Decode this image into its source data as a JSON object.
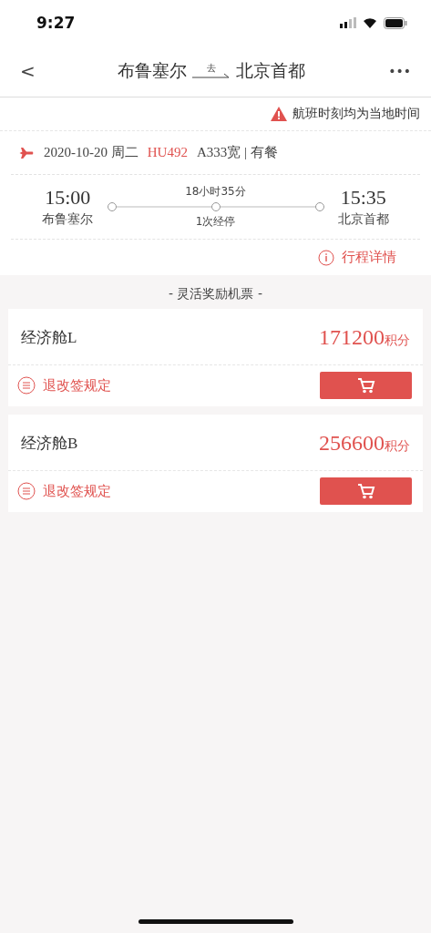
{
  "status_bar": {
    "time": "9:27"
  },
  "nav": {
    "back": "<",
    "origin": "布鲁塞尔",
    "direction": "去",
    "destination": "北京首都",
    "more": "•••"
  },
  "notice": "航班时刻均为当地时间",
  "flight": {
    "date": "2020-10-20 周二",
    "flight_no": "HU492",
    "aircraft": "A333宽 | 有餐",
    "depart_time": "15:00",
    "depart_city": "布鲁塞尔",
    "duration": "18小时35分",
    "stops": "1次经停",
    "arrive_time": "15:35",
    "arrive_city": "北京首都",
    "details_link": "行程详情"
  },
  "section_title": "- 灵活奖励机票 -",
  "fares": [
    {
      "cabin": "经济舱L",
      "points": "171200",
      "unit": "积分",
      "rules_link": "退改签规定"
    },
    {
      "cabin": "经济舱B",
      "points": "256600",
      "unit": "积分",
      "rules_link": "退改签规定"
    }
  ]
}
